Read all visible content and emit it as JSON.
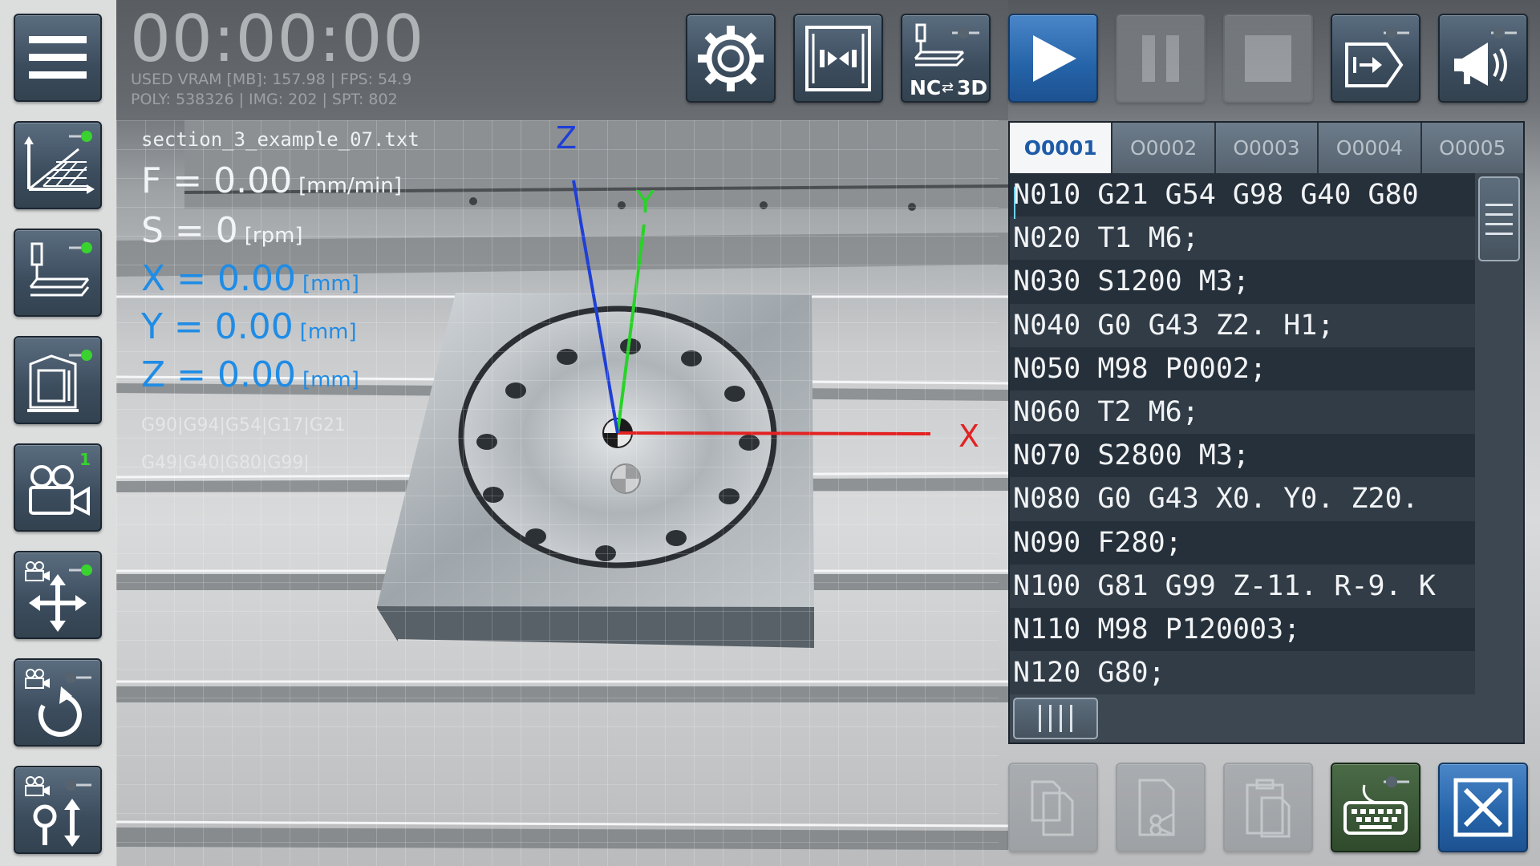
{
  "hud": {
    "time": "00:00:00",
    "stats_line1": "USED VRAM [MB]: 157.98 | FPS: 54.9",
    "stats_line2": "POLY: 538326 | IMG: 202 | SPT: 802"
  },
  "readout": {
    "file_name": "section_3_example_07.txt",
    "feed": "F = 0.00",
    "feed_unit": "[mm/min]",
    "spindle": "S = 0",
    "spindle_unit": "[rpm]",
    "x": "X = 0.00",
    "y": "Y = 0.00",
    "z": "Z = 0.00",
    "axis_unit": "[mm]",
    "modal_codes_1": "G90|G94|G54|G17|G21",
    "modal_codes_2": "G49|G40|G80|G99|"
  },
  "axes": {
    "x": "X",
    "y": "Y",
    "z": "Z"
  },
  "left_toolbar": [
    {
      "name": "menu",
      "icon": "hamburger-icon",
      "state": "active"
    },
    {
      "name": "workpiece-coordinates",
      "icon": "grid-axes-icon",
      "state": "toggle-on"
    },
    {
      "name": "tool-path",
      "icon": "tool-path-icon",
      "state": "toggle-on"
    },
    {
      "name": "machine-housing",
      "icon": "machine-icon",
      "state": "toggle-on"
    },
    {
      "name": "camera-select",
      "icon": "camera-icon",
      "badge": "1"
    },
    {
      "name": "camera-pan",
      "icon": "camera-move-icon",
      "state": "toggle-on"
    },
    {
      "name": "camera-rotate",
      "icon": "camera-rotate-icon",
      "state": "toggle-off"
    },
    {
      "name": "camera-zoom",
      "icon": "camera-zoom-icon",
      "state": "toggle-off"
    }
  ],
  "top_toolbar": {
    "settings": "settings-gear-icon",
    "machine_doors": "doors-icon",
    "nc_3d_label": "NC",
    "nc_3d_label2": "3D",
    "play": "play-icon",
    "pause": "pause-icon",
    "stop": "stop-icon",
    "export": "export-icon",
    "sound": "megaphone-icon"
  },
  "editor": {
    "tabs": [
      "O0001",
      "O0002",
      "O0003",
      "O0004",
      "O0005"
    ],
    "active_tab": "O0001",
    "lines": [
      "N010 G21 G54 G98 G40 G80",
      "N020 T1 M6;",
      "N030 S1200 M3;",
      "N040 G0 G43 Z2. H1;",
      "N050 M98 P0002;",
      "N060 T2 M6;",
      "N070 S2800 M3;",
      "N080 G0 G43 X0. Y0. Z20.",
      "N090 F280;",
      "N100 G81 G99 Z-11. R-9. K",
      "N110 M98 P120003;",
      "N120 G80;"
    ]
  },
  "bottom_toolbar": {
    "copy": "copy-icon",
    "cut": "cut-icon",
    "paste": "paste-icon",
    "keyboard": "keyboard-icon",
    "close": "close-icon"
  },
  "colors": {
    "button_dark": "#3b4c5d",
    "button_blue": "#2563a8",
    "readout_blue": "#1f8ce6",
    "toggle_green": "#39d22f",
    "axis_x": "#e32222",
    "axis_y": "#27d327",
    "axis_z": "#1f3fd6",
    "active_tab_text": "#1d5aa7"
  }
}
